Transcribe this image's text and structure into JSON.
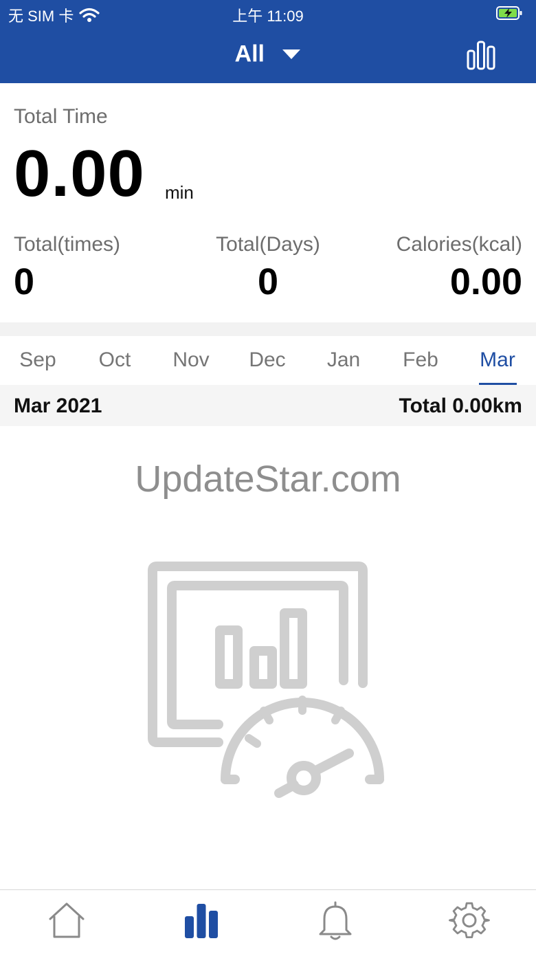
{
  "status_bar": {
    "carrier": "无 SIM 卡",
    "time": "上午 11:09",
    "icons": [
      "wifi-icon",
      "battery-charging-icon"
    ]
  },
  "nav": {
    "title": "All",
    "title_icon": "caret-down-icon",
    "right_icon": "bar-chart-icon"
  },
  "summary": {
    "total_time_label": "Total Time",
    "total_time_value": "0.00",
    "total_time_unit": "min",
    "stats": [
      {
        "label": "Total(times)",
        "value": "0"
      },
      {
        "label": "Total(Days)",
        "value": "0"
      },
      {
        "label": "Calories(kcal)",
        "value": "0.00"
      }
    ]
  },
  "months": {
    "items": [
      "Sep",
      "Oct",
      "Nov",
      "Dec",
      "Jan",
      "Feb",
      "Mar"
    ],
    "selected": "Mar"
  },
  "period": {
    "label": "Mar 2021",
    "total": "Total 0.00km"
  },
  "watermark": "UpdateStar.com",
  "empty_state": {
    "icon": "empty-stats-speedometer-icon"
  },
  "tab_bar": {
    "tabs": [
      {
        "icon": "home-icon",
        "active": false
      },
      {
        "icon": "stats-icon",
        "active": true
      },
      {
        "icon": "bell-icon",
        "active": false
      },
      {
        "icon": "gear-icon",
        "active": false
      }
    ]
  },
  "colors": {
    "brand_blue": "#1f4ea3",
    "inactive_gray": "#757575",
    "illustration_gray": "#cfcfcf"
  }
}
